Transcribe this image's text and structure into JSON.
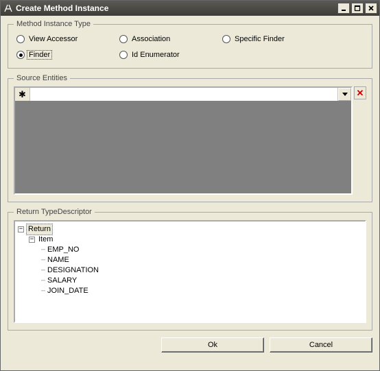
{
  "window": {
    "title": "Create Method Instance"
  },
  "methodType": {
    "legend": "Method Instance Type",
    "options": [
      {
        "label": "View Accessor",
        "selected": false
      },
      {
        "label": "Association",
        "selected": false
      },
      {
        "label": "Specific Finder",
        "selected": false
      },
      {
        "label": "Finder",
        "selected": true
      },
      {
        "label": "Id Enumerator",
        "selected": false
      }
    ]
  },
  "sourceEntities": {
    "legend": "Source Entities",
    "row_marker": "✱",
    "field_value": "",
    "delete_marker": "✕"
  },
  "returnType": {
    "legend": "Return TypeDescriptor",
    "tree": {
      "root": {
        "label": "Return",
        "expanded": true,
        "selected": true
      },
      "item": {
        "label": "Item",
        "expanded": true
      },
      "fields": [
        "EMP_NO",
        "NAME",
        "DESIGNATION",
        "SALARY",
        "JOIN_DATE"
      ]
    }
  },
  "buttons": {
    "ok": "Ok",
    "cancel": "Cancel"
  }
}
